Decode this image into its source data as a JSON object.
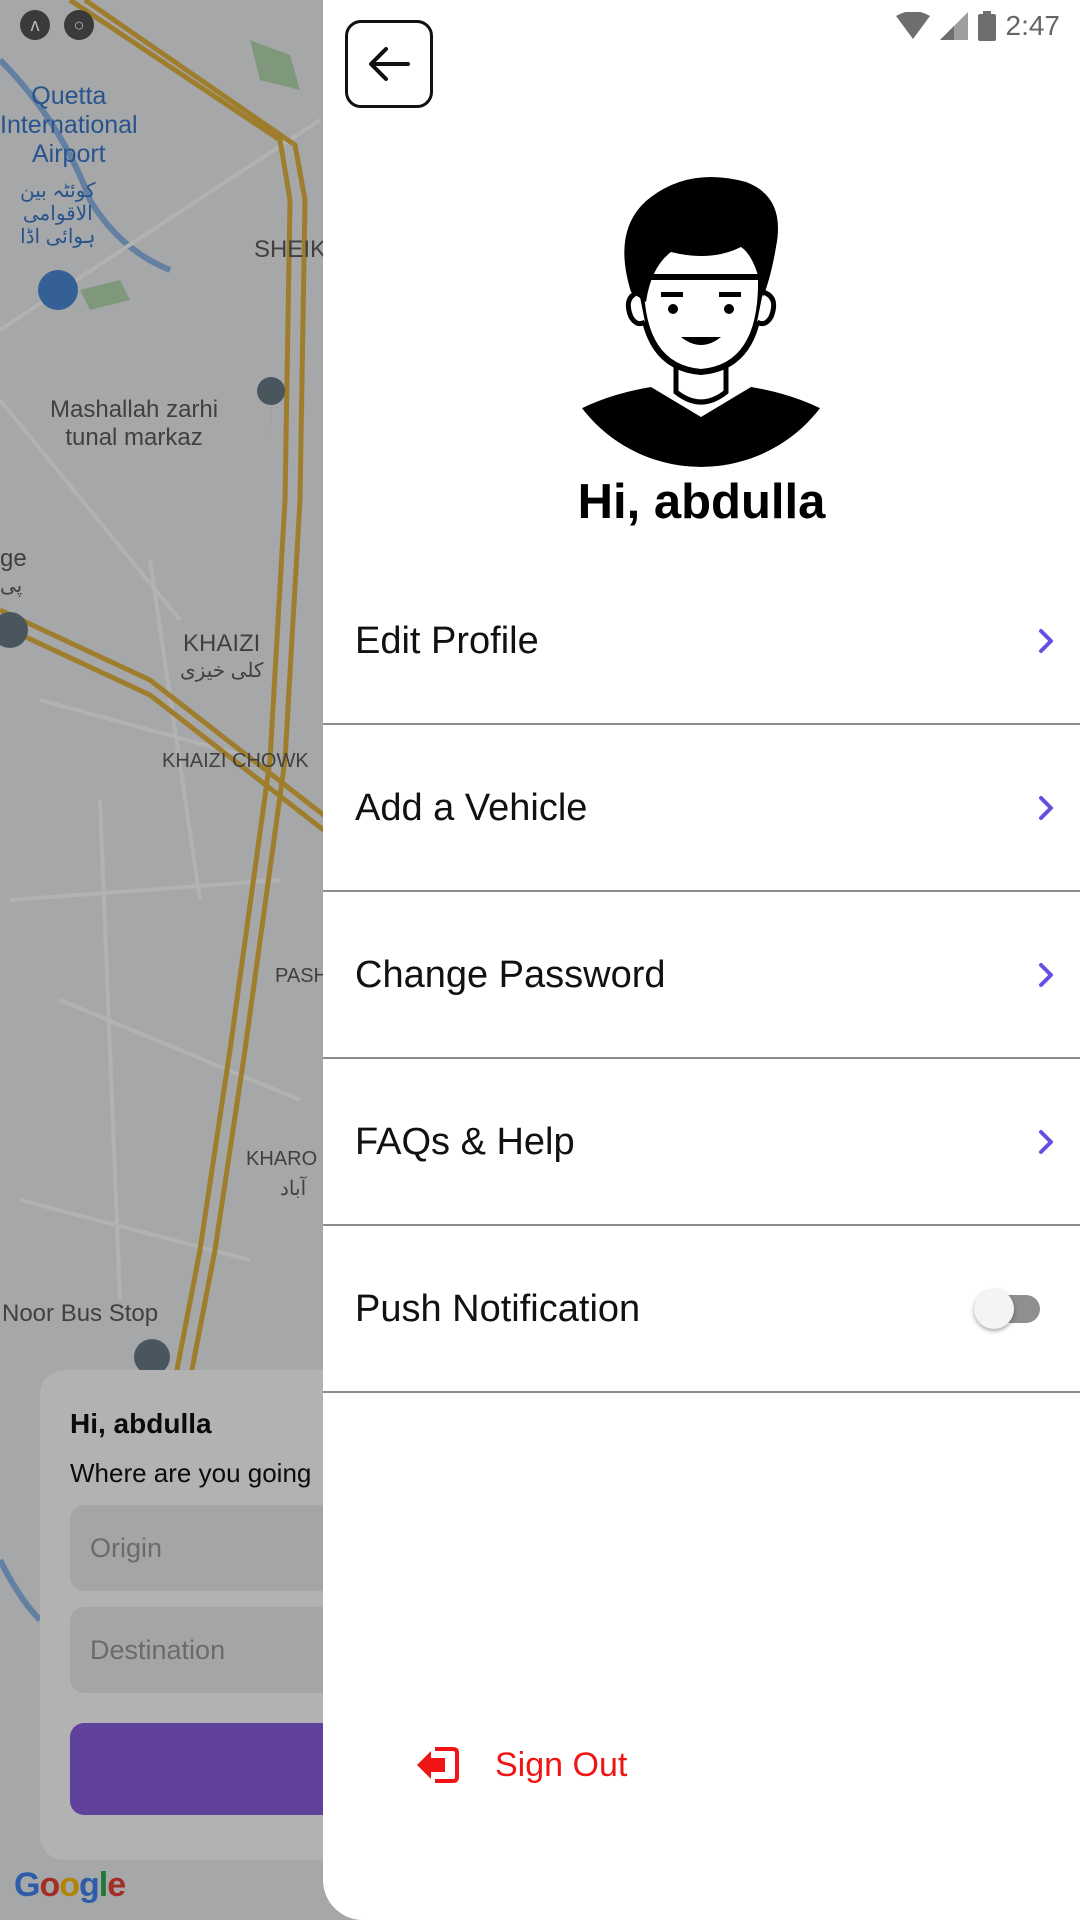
{
  "status_bar": {
    "time": "2:47"
  },
  "map": {
    "labels": {
      "airport": "Quetta\nInternational\nAirport",
      "airport_urdu": "کوئٹہ بین\nالاقوامی\nہوائی اڈا",
      "sheikh": "SHEIKH",
      "mashallah": "Mashallah zarhi\ntunal markaz",
      "ge": "ge",
      "ge_urdu": "پی",
      "khaizi": "KHAIZI",
      "khaizi_urdu": "کلی خیزی",
      "khaizi_chowk": "KHAIZI CHOWK",
      "pasht": "PASHT",
      "kharo": "KHARO",
      "kharo_urdu": "آباد",
      "noor_bus_stop": "Noor Bus Stop"
    },
    "google_logo": "Google",
    "colors": {
      "road": "#e3b341",
      "water": "#8fb6e8",
      "park": "#b6d9b1"
    }
  },
  "trip_card": {
    "greeting": "Hi, abdulla",
    "question": "Where are you going",
    "origin_placeholder": "Origin",
    "destination_placeholder": "Destination",
    "button_color": "#8a5fe0"
  },
  "drawer": {
    "greeting": "Hi, abdulla",
    "menu": [
      {
        "label": "Edit Profile"
      },
      {
        "label": "Add a Vehicle"
      },
      {
        "label": "Change Password"
      },
      {
        "label": "FAQs & Help"
      },
      {
        "label": "Push Notification",
        "toggle_on": false
      }
    ],
    "sign_out": "Sign Out",
    "colors": {
      "chevron": "#6a4ee0",
      "sign_out": "#f01515"
    }
  }
}
